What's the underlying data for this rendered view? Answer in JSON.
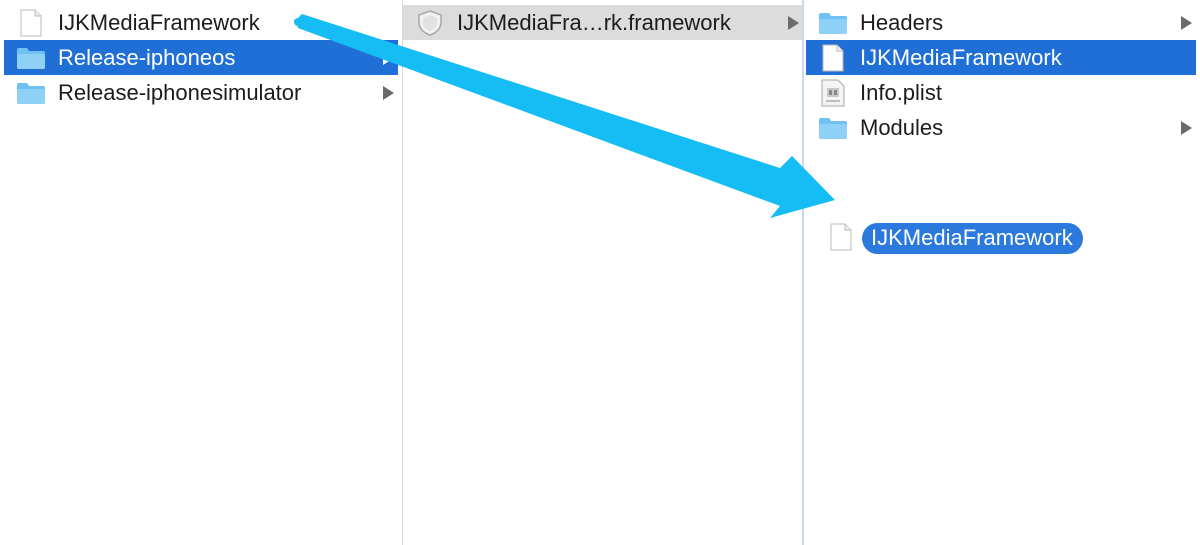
{
  "columns": [
    {
      "items": [
        {
          "label": "IJKMediaFramework",
          "icon": "document-icon",
          "state": "none",
          "has_children": false
        },
        {
          "label": "Release-iphoneos",
          "icon": "folder-icon",
          "state": "selected",
          "has_children": true
        },
        {
          "label": "Release-iphonesimulator",
          "icon": "folder-icon",
          "state": "none",
          "has_children": true
        }
      ]
    },
    {
      "items": [
        {
          "label": "IJKMediaFra…rk.framework",
          "icon": "framework-icon",
          "state": "selected-inactive",
          "has_children": true
        }
      ]
    },
    {
      "items": [
        {
          "label": "Headers",
          "icon": "folder-icon",
          "state": "none",
          "has_children": true
        },
        {
          "label": "IJKMediaFramework",
          "icon": "document-icon",
          "state": "selected",
          "has_children": false
        },
        {
          "label": "Info.plist",
          "icon": "plist-icon",
          "state": "none",
          "has_children": false
        },
        {
          "label": "Modules",
          "icon": "folder-icon",
          "state": "none",
          "has_children": true
        }
      ]
    }
  ],
  "drag_ghost": {
    "label": "IJKMediaFramework",
    "icon": "document-icon"
  },
  "colors": {
    "selection": "#1f6fd6",
    "selection_inactive": "#dcdcdc",
    "drag_pill": "#2b79dc",
    "annotation_arrow": "#16bdf5",
    "folder": "#6ec1f2"
  }
}
